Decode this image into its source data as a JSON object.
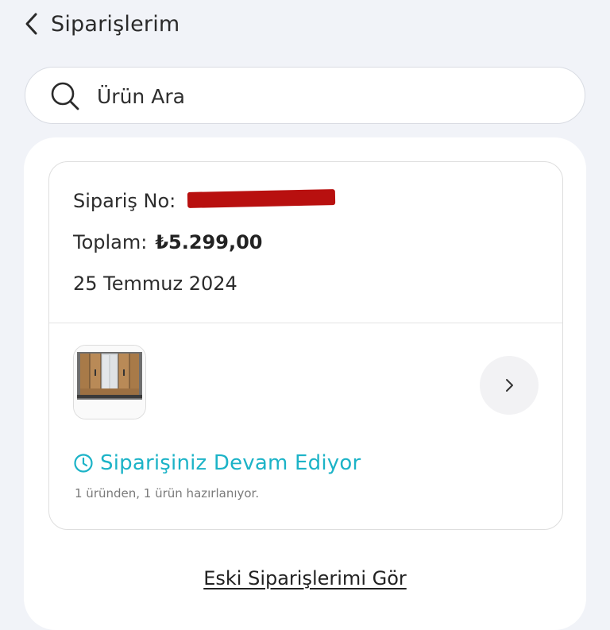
{
  "header": {
    "title": "Siparişlerim",
    "back_icon": "chevron-left-icon"
  },
  "search": {
    "placeholder": "Ürün Ara",
    "icon": "search-icon"
  },
  "order": {
    "number_label": "Sipariş No:",
    "number_value_redacted": true,
    "total_label": "Toplam:",
    "total_value": "₺5.299,00",
    "date": "25 Temmuz 2024",
    "product_thumbnail": "wardrobe-image",
    "detail_icon": "chevron-right-icon",
    "status": {
      "icon": "clock-icon",
      "text": "Siparişiniz Devam Ediyor",
      "detail": "1 üründen, 1 ürün hazırlanıyor.",
      "color": "#1cb3c7"
    }
  },
  "footer": {
    "old_orders_link": "Eski Siparişlerimi Gör"
  },
  "colors": {
    "background": "#f1f3f8",
    "surface": "#ffffff",
    "accent": "#1cb3c7",
    "redaction": "#b8100f"
  }
}
